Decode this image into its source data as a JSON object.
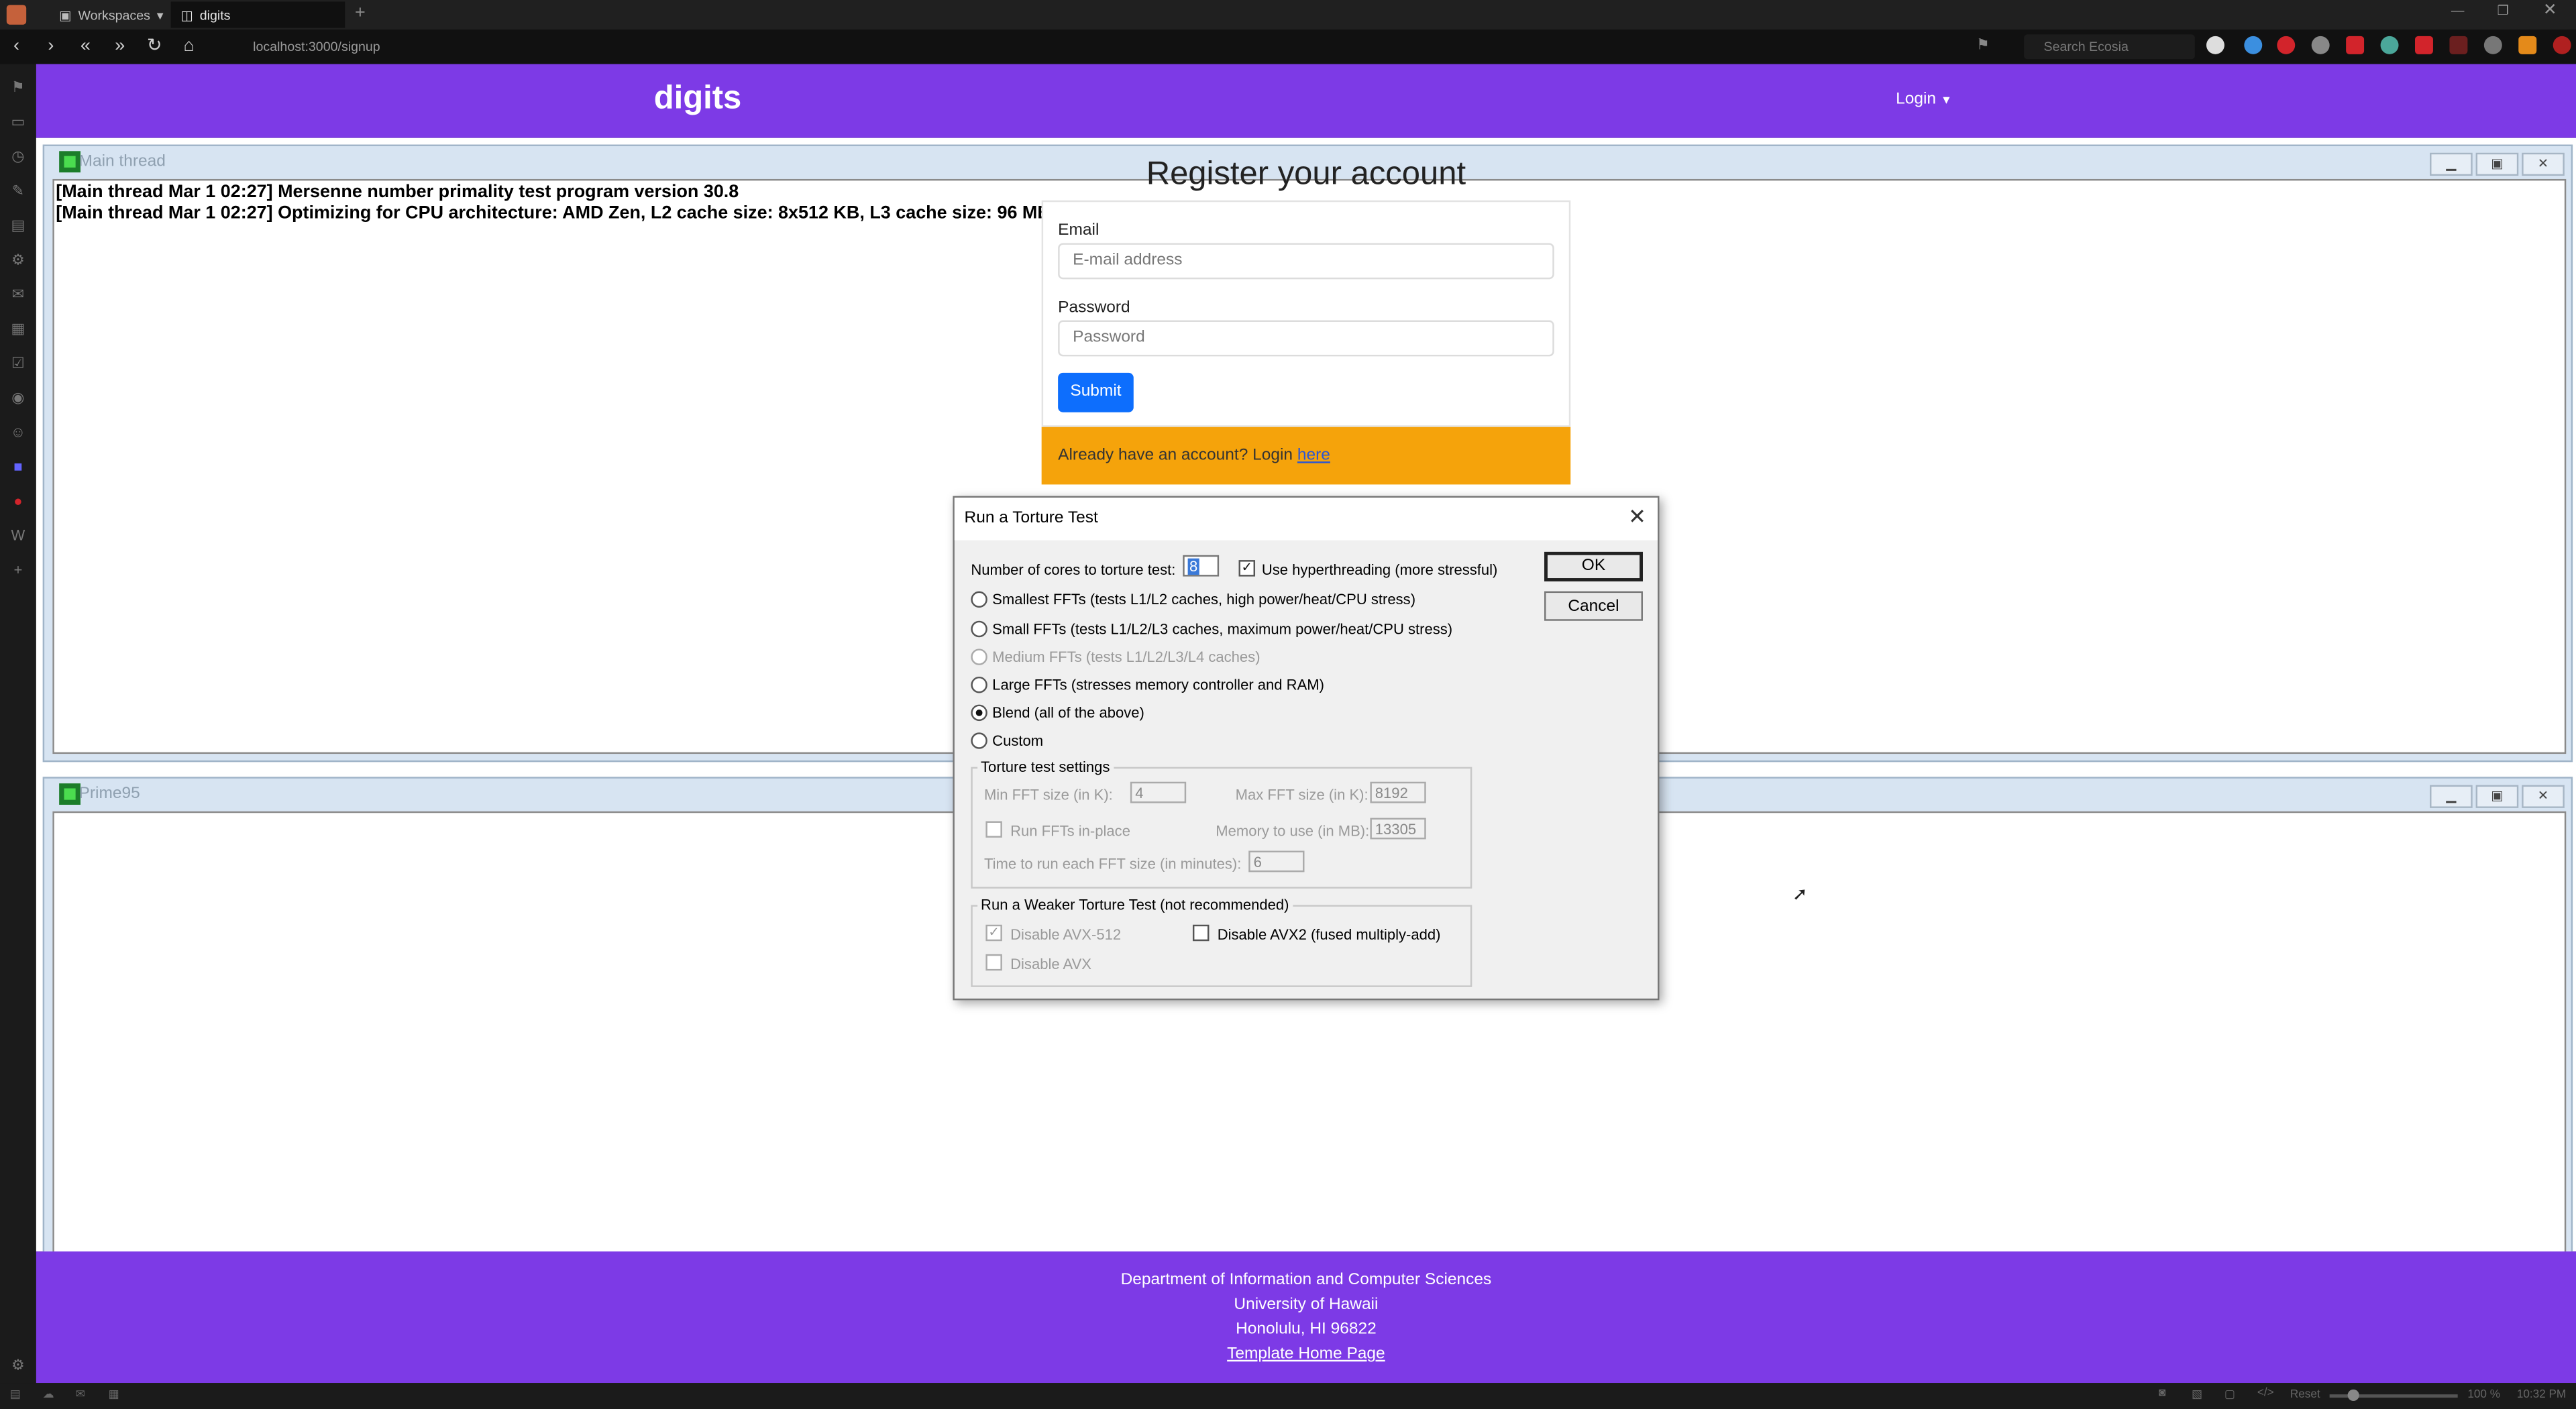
{
  "browser": {
    "tabs": [
      {
        "label": "Workspaces"
      },
      {
        "label": "digits"
      }
    ],
    "url": "localhost:3000/signup",
    "search_placeholder": "Search Ecosia",
    "status_zoom": "100 %",
    "status_reset": "Reset",
    "clock": "10:32 PM"
  },
  "site": {
    "brand": "digits",
    "login_menu": "Login"
  },
  "register": {
    "heading": "Register your account",
    "email_label": "Email",
    "email_placeholder": "E-mail address",
    "password_label": "Password",
    "password_placeholder": "Password",
    "submit_label": "Submit",
    "login_prompt": "Already have an account? Login",
    "login_link": "here"
  },
  "footer": {
    "line1": "Department of Information and Computer Sciences",
    "line2": "University of Hawaii",
    "line3": "Honolulu, HI 96822",
    "link": "Template Home Page"
  },
  "prime95": {
    "main_window_title": "Main thread",
    "log": [
      "[Main thread Mar 1 02:27] Mersenne number primality test program version 30.8",
      "[Main thread Mar 1 02:27] Optimizing for CPU architecture: AMD Zen, L2 cache size: 8x512 KB, L3 cache size: 96 MB"
    ],
    "second_window_title": "Prime95"
  },
  "torture_dialog": {
    "title": "Run a Torture Test",
    "cores_label": "Number of cores to torture test:",
    "cores_value": "8",
    "hyperthreading_label": "Use hyperthreading (more stressful)",
    "hyperthreading_checked": true,
    "options": [
      {
        "label": "Smallest FFTs (tests L1/L2 caches, high power/heat/CPU stress)",
        "selected": false,
        "disabled": false
      },
      {
        "label": "Small FFTs (tests L1/L2/L3 caches, maximum power/heat/CPU stress)",
        "selected": false,
        "disabled": false
      },
      {
        "label": "Medium FFTs (tests L1/L2/L3/L4 caches)",
        "selected": false,
        "disabled": true
      },
      {
        "label": "Large FFTs (stresses memory controller and RAM)",
        "selected": false,
        "disabled": false
      },
      {
        "label": "Blend (all of the above)",
        "selected": true,
        "disabled": false
      },
      {
        "label": "Custom",
        "selected": false,
        "disabled": false
      }
    ],
    "settings_group": "Torture test settings",
    "min_fft_label": "Min FFT size (in K):",
    "min_fft_value": "4",
    "max_fft_label": "Max FFT size (in K):",
    "max_fft_value": "8192",
    "inplace_label": "Run FFTs in-place",
    "memory_label": "Memory to use (in MB):",
    "memory_value": "13305",
    "time_label": "Time to run each FFT size (in minutes):",
    "time_value": "6",
    "weaker_group": "Run a Weaker Torture Test (not recommended)",
    "disable_avx512_label": "Disable AVX-512",
    "disable_avx512_checked": true,
    "disable_avx2_label": "Disable AVX2 (fused multiply-add)",
    "disable_avx2_checked": false,
    "disable_avx_label": "Disable AVX",
    "disable_avx_checked": false,
    "ok_label": "OK",
    "cancel_label": "Cancel"
  },
  "colors": {
    "navbar": "#7d3ae6",
    "submit": "#0d6efd",
    "alert": "#f5a30b"
  }
}
